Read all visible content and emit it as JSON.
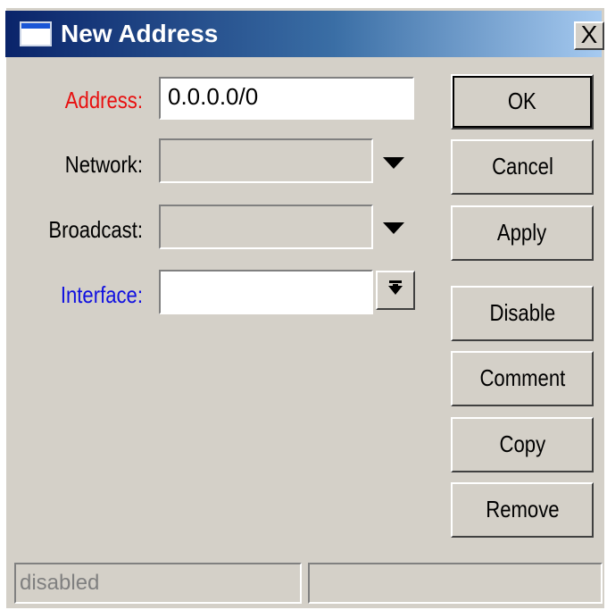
{
  "window": {
    "title": "New Address",
    "close_label": "X"
  },
  "form": {
    "address": {
      "label": "Address:",
      "value": "0.0.0.0/0",
      "label_color": "#e81010"
    },
    "network": {
      "label": "Network:",
      "value": ""
    },
    "broadcast": {
      "label": "Broadcast:",
      "value": ""
    },
    "interface": {
      "label": "Interface:",
      "value": "",
      "label_color": "#1010e0"
    }
  },
  "buttons": {
    "ok": "OK",
    "cancel": "Cancel",
    "apply": "Apply",
    "disable": "Disable",
    "comment": "Comment",
    "copy": "Copy",
    "remove": "Remove"
  },
  "status": {
    "left": "disabled",
    "right": ""
  },
  "icons": {
    "title": "window-icon",
    "close": "close-icon",
    "network_dropdown": "triangle-down-icon",
    "broadcast_dropdown": "triangle-down-icon",
    "interface_dropdown": "down-arrow-bar-icon"
  }
}
